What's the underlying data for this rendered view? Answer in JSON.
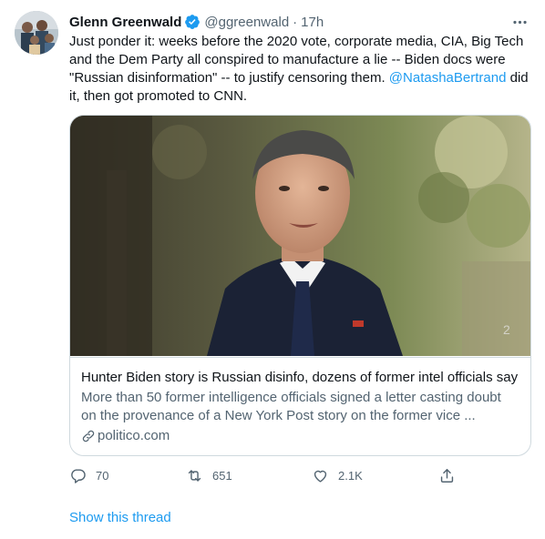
{
  "author": {
    "name": "Glenn Greenwald",
    "handle": "@ggreenwald",
    "separator": "·",
    "time": "17h"
  },
  "tweet": {
    "text_before": "Just ponder it: weeks before the 2020 vote, corporate media, CIA, Big Tech and the Dem Party all conspired to manufacture a lie -- Biden docs were \"Russian disinformation\" -- to justify censoring them. ",
    "mention": "@NatashaBertrand",
    "text_after": " did it, then got promoted to CNN."
  },
  "card": {
    "title": "Hunter Biden story is Russian disinfo, dozens of former intel officials say",
    "description": "More than 50 former intelligence officials signed a letter casting doubt on the provenance of a New York Post story on the former vice ...",
    "domain": "politico.com"
  },
  "actions": {
    "reply_count": "70",
    "retweet_count": "651",
    "like_count": "2.1K"
  },
  "show_thread_label": "Show this thread",
  "colors": {
    "accent": "#1d9bf0",
    "secondary_text": "#536471",
    "border": "#cfd9de"
  },
  "icons": [
    "verified-badge-icon",
    "more-icon",
    "link-icon",
    "reply-icon",
    "retweet-icon",
    "like-icon",
    "share-icon"
  ]
}
